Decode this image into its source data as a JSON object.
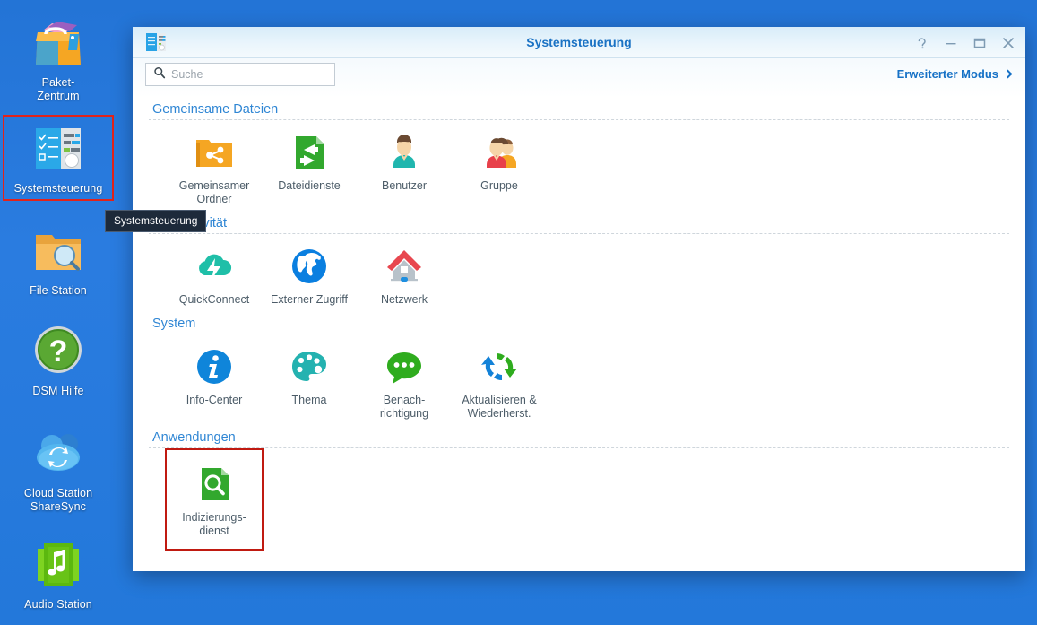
{
  "desktop": {
    "icons": [
      {
        "name": "package-center",
        "label": "Paket-\nZentrum",
        "label_line1": "Paket-",
        "label_line2": "Zentrum",
        "icon": "package-center-icon",
        "selected": false
      },
      {
        "name": "control-panel",
        "label": "Systemsteuerung",
        "label_line1": "Systemsteuerung",
        "label_line2": "",
        "icon": "control-panel-icon",
        "selected": true
      },
      {
        "name": "file-station",
        "label": "File Station",
        "label_line1": "File Station",
        "label_line2": "",
        "icon": "file-station-icon",
        "selected": false
      },
      {
        "name": "dsm-help",
        "label": "DSM Hilfe",
        "label_line1": "DSM Hilfe",
        "label_line2": "",
        "icon": "dsm-help-icon",
        "selected": false
      },
      {
        "name": "cloud-station-sharesync",
        "label": "Cloud Station ShareSync",
        "label_line1": "Cloud Station",
        "label_line2": "ShareSync",
        "icon": "cloud-sync-icon",
        "selected": false
      },
      {
        "name": "audio-station",
        "label": "Audio Station",
        "label_line1": "Audio Station",
        "label_line2": "",
        "icon": "audio-station-icon",
        "selected": false
      }
    ],
    "tooltip": "Systemsteuerung",
    "selection_color": "#e2231a"
  },
  "window": {
    "title": "Systemsteuerung",
    "app_icon": "control-panel-icon",
    "buttons": {
      "help": "?",
      "minimize": "–",
      "maximize": "▭",
      "close": "✕"
    }
  },
  "toolbar": {
    "search_placeholder": "Suche",
    "search_value": "",
    "search_icon": "search-icon",
    "advanced_mode_label": "Erweiterter Modus",
    "advanced_mode_icon": "chevron-right-icon",
    "link_color": "#1671c6"
  },
  "sections": [
    {
      "title": "Gemeinsame Dateien",
      "items": [
        {
          "name": "shared-folder",
          "label_line1": "Gemeinsamer",
          "label_line2": "Ordner",
          "icon": "shared-folder-icon",
          "highlighted": false
        },
        {
          "name": "file-services",
          "label_line1": "Dateidienste",
          "label_line2": "",
          "icon": "file-services-icon",
          "highlighted": false
        },
        {
          "name": "user",
          "label_line1": "Benutzer",
          "label_line2": "",
          "icon": "user-icon",
          "highlighted": false
        },
        {
          "name": "group",
          "label_line1": "Gruppe",
          "label_line2": "",
          "icon": "group-icon",
          "highlighted": false
        }
      ]
    },
    {
      "title": "Konnektivität",
      "items": [
        {
          "name": "quickconnect",
          "label_line1": "QuickConnect",
          "label_line2": "",
          "icon": "quickconnect-cloud-icon",
          "highlighted": false
        },
        {
          "name": "external-access",
          "label_line1": "Externer Zugriff",
          "label_line2": "",
          "icon": "globe-icon",
          "highlighted": false
        },
        {
          "name": "network",
          "label_line1": "Netzwerk",
          "label_line2": "",
          "icon": "network-house-icon",
          "highlighted": false
        }
      ]
    },
    {
      "title": "System",
      "items": [
        {
          "name": "info-center",
          "label_line1": "Info-Center",
          "label_line2": "",
          "icon": "info-icon",
          "highlighted": false
        },
        {
          "name": "theme",
          "label_line1": "Thema",
          "label_line2": "",
          "icon": "palette-icon",
          "highlighted": false
        },
        {
          "name": "notification",
          "label_line1": "Benach-",
          "label_line2": "richtigung",
          "icon": "speech-bubble-icon",
          "highlighted": false
        },
        {
          "name": "update-restore",
          "label_line1": "Aktualisieren &",
          "label_line2": "Wiederherst.",
          "icon": "refresh-arrows-icon",
          "highlighted": false
        }
      ]
    },
    {
      "title": "Anwendungen",
      "items": [
        {
          "name": "indexing-service",
          "label_line1": "Indizierungs-",
          "label_line2": "dienst",
          "icon": "indexing-magnifier-icon",
          "highlighted": true
        }
      ]
    }
  ],
  "colors": {
    "desktop_background": "#2a7ce0",
    "window_background": "#ffffff",
    "title_text": "#1a72c4",
    "section_title": "#2f86d4",
    "tile_label": "#4c5c68",
    "highlight_red": "#c01a11",
    "tooltip_background": "#1d2a3a"
  }
}
